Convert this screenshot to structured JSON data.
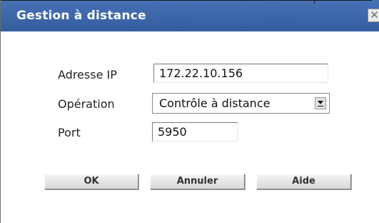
{
  "dialog": {
    "title": "Gestion à distance",
    "close_glyph": "✕",
    "close_icon": "close-icon"
  },
  "form": {
    "ip_label": "Adresse IP",
    "ip_value": "172.22.10.156",
    "operation_label": "Opération",
    "operation_value": "Contrôle à distance",
    "port_label": "Port",
    "port_value": "5950"
  },
  "buttons": {
    "ok": "OK",
    "cancel": "Annuler",
    "help": "Aide"
  },
  "colors": {
    "titlebar": "#3b69ad",
    "title_text": "#ffffff",
    "background": "#ffffff"
  }
}
